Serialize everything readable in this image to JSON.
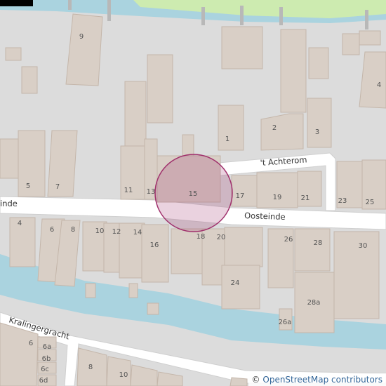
{
  "attribution": {
    "symbol": "©",
    "link_text": "OpenStreetMap contributors"
  },
  "streets": {
    "oosteinde_left": "inde",
    "oosteinde_right": "Oosteinde",
    "achterom": "'t Achterom",
    "kralingergracht": "Kralingergracht"
  },
  "house_numbers": {
    "n9": "9",
    "n1": "1",
    "n2": "2",
    "n3": "3",
    "n4_top": "4",
    "n5": "5",
    "n7": "7",
    "n11": "11",
    "n13": "13",
    "n15": "15",
    "n17": "17",
    "n19": "19",
    "n21": "21",
    "n23": "23",
    "n25": "25",
    "n4": "4",
    "n6": "6",
    "n8": "8",
    "n10": "10",
    "n12": "12",
    "n14": "14",
    "n16": "16",
    "n18": "18",
    "n20": "20",
    "n26": "26",
    "n28": "28",
    "n30": "30",
    "n24": "24",
    "n28a": "28a",
    "n26a": "26a",
    "k6": "6",
    "k6a": "6a",
    "k6b": "6b",
    "k6c": "6c",
    "k6d": "6d",
    "k8": "8",
    "k10": "10"
  },
  "colors": {
    "background": "#dcdcdc",
    "water": "#aad3df",
    "grass": "#cdebb0",
    "building": "#d9cfc6",
    "road": "#ffffff",
    "highlight_circle": "#a0306c"
  }
}
